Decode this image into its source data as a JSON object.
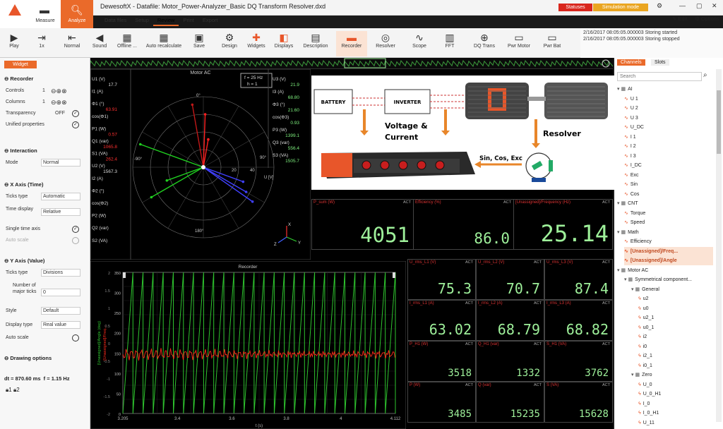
{
  "app": {
    "title": "DewesoftX - Datafile: Motor_Power-Analyzer_Basic DQ Transform Resolver.dxd",
    "modes": [
      {
        "label": "Measure"
      },
      {
        "label": "Analyze"
      }
    ],
    "menu_tabs": [
      "Data files",
      "Setup",
      "Review",
      "Print",
      "Export"
    ],
    "badge_status": "Statuses",
    "badge_sim": "Simulation mode",
    "edit": "Edit",
    "options": "Options"
  },
  "toolbar": [
    {
      "label": "Play",
      "icon": "play-icon"
    },
    {
      "label": "1x",
      "icon": "speed-icon"
    },
    {
      "label": "Normal",
      "icon": "normal-icon"
    },
    {
      "label": "Sound",
      "icon": "sound-icon"
    },
    {
      "label": "Offline ...",
      "icon": "calculator-icon"
    },
    {
      "label": "Auto recalculate",
      "icon": "recalculate-icon"
    },
    {
      "label": "Save",
      "icon": "save-icon"
    },
    {
      "label": "Design",
      "icon": "gear-icon"
    },
    {
      "label": "Widgets",
      "icon": "plus-icon"
    },
    {
      "label": "Displays",
      "icon": "displays-icon"
    },
    {
      "label": "Description",
      "icon": "description-icon"
    },
    {
      "label": "Recorder",
      "icon": "recorder-icon"
    },
    {
      "label": "Resolver",
      "icon": "resolver-icon"
    },
    {
      "label": "Scope",
      "icon": "scope-icon"
    },
    {
      "label": "FFT",
      "icon": "fft-icon"
    },
    {
      "label": "DQ Trans",
      "icon": "dq-icon"
    },
    {
      "label": "Pwr Motor",
      "icon": "motor-icon"
    },
    {
      "label": "Pwr Bat",
      "icon": "battery-icon"
    }
  ],
  "log": [
    "2/16/2017 08:05:05.000003 Storing started",
    "2/16/2017 08:05:05.000003 Storing stopped"
  ],
  "left_panel": {
    "tab": "Widget",
    "recorder": {
      "title": "Recorder",
      "controls_label": "Controls",
      "controls_value": "1",
      "columns_label": "Columns",
      "columns_value": "1",
      "transparency_label": "Transparency",
      "transparency_value": "OFF",
      "unified_label": "Unified properties"
    },
    "interaction": {
      "title": "Interaction",
      "mode_label": "Mode",
      "mode_value": "Normal"
    },
    "x_axis": {
      "title": "X Axis (Time)",
      "ticks_label": "Ticks type",
      "ticks_value": "Automatic",
      "time_label": "Time display",
      "time_value": "Relative",
      "single_label": "Single time axis",
      "auto_label": "Auto scale"
    },
    "y_axis": {
      "title": "Y Axis (Value)",
      "ticks_label": "Ticks type",
      "ticks_value": "Divisions",
      "major_label": "Number of major ticks",
      "major_value": "0",
      "style_label": "Style",
      "style_value": "Default",
      "disp_label": "Display type",
      "disp_value": "Real value",
      "auto_label": "Auto scale"
    },
    "drawing": {
      "title": "Drawing options"
    },
    "dt": "dt = 870.60 ms",
    "f": "f = 1.15 Hz",
    "lock1": "1",
    "lock2": "2"
  },
  "vector": {
    "title": "Motor AC",
    "f_value": "f = 25 Hz",
    "h_value": "h = 1",
    "left_labels": [
      "U1 (V)",
      "I1 (A)",
      "Φ1 (°)",
      "cos(Φ1)",
      "P1 (W)",
      "Q1 (var)",
      "S1 (VA)",
      "U2 (V)",
      "I2 (A)",
      "Φ2 (°)",
      "cos(Φ2)",
      "P2 (W)",
      "Q2 (var)",
      "S2 (VA)"
    ],
    "left_values": [
      "17.7",
      "",
      "63.91",
      "",
      "0.57",
      "1065.8",
      "262.4",
      "1567.3",
      "",
      "",
      "",
      "",
      "",
      ""
    ],
    "right_labels": [
      "U3 (V)",
      "I3 (A)",
      "Φ3 (°)",
      "cos(Φ3)",
      "P3 (W)",
      "Q3 (var)",
      "S3 (VA)"
    ],
    "right_values": [
      "21.9",
      "68.80",
      "21.60",
      "0.93",
      "1399.1",
      "556.4",
      "1505.7"
    ],
    "angle_0": "0°",
    "angle_90": "90°",
    "angle_m90": "-90°",
    "angle_180": "180°",
    "scale_20": "20",
    "scale_40": "40",
    "u_axis": "U [V]",
    "ax_x": "X",
    "ax_y": "Y",
    "ax_z": "Z"
  },
  "diagram": {
    "battery": "BATTERY",
    "inverter": "INVERTER",
    "voltage": "Voltage &",
    "current": "Current",
    "resolver": "Resolver",
    "signals": "Sin, Cos, Exc"
  },
  "displays_top": [
    {
      "label": "P_sum (W)",
      "value": "4051",
      "act": "ACT"
    },
    {
      "label": "Efficiency (%)",
      "value": "86.0",
      "act": "ACT"
    },
    {
      "label": "[Unassigned]/Frequency (Hz)",
      "value": "25.14",
      "act": "ACT"
    }
  ],
  "displays_grid": [
    {
      "label": "U_rms_L1 (V)",
      "value": "75.3",
      "act": "ACT"
    },
    {
      "label": "U_rms_L2 (V)",
      "value": "70.7",
      "act": "ACT"
    },
    {
      "label": "U_rms_L3 (V)",
      "value": "87.4",
      "act": "ACT"
    },
    {
      "label": "I_rms_L1 (A)",
      "value": "63.02",
      "act": "ACT"
    },
    {
      "label": "I_rms_L2 (A)",
      "value": "68.79",
      "act": "ACT"
    },
    {
      "label": "I_rms_L3 (A)",
      "value": "68.82",
      "act": "ACT"
    },
    {
      "label": "P_H1 (W)",
      "value": "3518",
      "act": "ACT"
    },
    {
      "label": "Q_H1 (var)",
      "value": "1332",
      "act": "ACT"
    },
    {
      "label": "S_H1 (VA)",
      "value": "3762",
      "act": "ACT"
    },
    {
      "label": "P (W)",
      "value": "3485",
      "act": "ACT"
    },
    {
      "label": "Q (var)",
      "value": "15235",
      "act": "ACT"
    },
    {
      "label": "S (VA)",
      "value": "15628",
      "act": "ACT"
    }
  ],
  "recorder": {
    "title": "Recorder",
    "x_ticks": [
      "3.205",
      "3.4",
      "3.6",
      "3.8",
      "4",
      "4.112"
    ],
    "xlabel": "t (s)",
    "y_ticks_left": [
      "2",
      "1.5",
      "1",
      "0.5",
      "0",
      "-0.5",
      "-1",
      "-1.5",
      "-2"
    ],
    "y_ticks_right": [
      "350",
      "300",
      "250",
      "200",
      "150",
      "100",
      "50",
      "0"
    ],
    "ylabel_left": "[Unassigned]/Angle (deg)",
    "ylabel_right": "[Unassigned]/Freq..."
  },
  "channels": {
    "tabs": [
      "Channels",
      "Slots"
    ],
    "search_placeholder": "Search",
    "tree": [
      {
        "t": "g",
        "d": 0,
        "label": "AI"
      },
      {
        "t": "c",
        "d": 1,
        "label": "U 1"
      },
      {
        "t": "c",
        "d": 1,
        "label": "U 2"
      },
      {
        "t": "c",
        "d": 1,
        "label": "U 3"
      },
      {
        "t": "c",
        "d": 1,
        "label": "U_DC"
      },
      {
        "t": "c",
        "d": 1,
        "label": "I 1"
      },
      {
        "t": "c",
        "d": 1,
        "label": "I 2"
      },
      {
        "t": "c",
        "d": 1,
        "label": "I 3"
      },
      {
        "t": "c",
        "d": 1,
        "label": "I_DC"
      },
      {
        "t": "c",
        "d": 1,
        "label": "Exc"
      },
      {
        "t": "c",
        "d": 1,
        "label": "Sin"
      },
      {
        "t": "c",
        "d": 1,
        "label": "Cos"
      },
      {
        "t": "g",
        "d": 0,
        "label": "CNT"
      },
      {
        "t": "c",
        "d": 1,
        "label": "Torque"
      },
      {
        "t": "c",
        "d": 1,
        "label": "Speed"
      },
      {
        "t": "g",
        "d": 0,
        "label": "Math"
      },
      {
        "t": "c",
        "d": 1,
        "label": "Efficiency"
      },
      {
        "t": "h",
        "d": 1,
        "label": "[Unassigned]/Freq..."
      },
      {
        "t": "h",
        "d": 1,
        "label": "[Unassigned]/Angle"
      },
      {
        "t": "g",
        "d": 0,
        "label": "Motor AC"
      },
      {
        "t": "g",
        "d": 1,
        "label": "Symmetrical component..."
      },
      {
        "t": "g",
        "d": 2,
        "label": "General"
      },
      {
        "t": "c",
        "d": 3,
        "label": "u2"
      },
      {
        "t": "c",
        "d": 3,
        "label": "u0"
      },
      {
        "t": "c",
        "d": 3,
        "label": "u2_1"
      },
      {
        "t": "c",
        "d": 3,
        "label": "u0_1"
      },
      {
        "t": "c",
        "d": 3,
        "label": "i2"
      },
      {
        "t": "c",
        "d": 3,
        "label": "i0"
      },
      {
        "t": "c",
        "d": 3,
        "label": "i2_1"
      },
      {
        "t": "c",
        "d": 3,
        "label": "i0_1"
      },
      {
        "t": "g",
        "d": 2,
        "label": "Zero"
      },
      {
        "t": "c",
        "d": 3,
        "label": "U_0"
      },
      {
        "t": "c",
        "d": 3,
        "label": "U_0_H1"
      },
      {
        "t": "c",
        "d": 3,
        "label": "I_0"
      },
      {
        "t": "c",
        "d": 3,
        "label": "I_0_H1"
      },
      {
        "t": "c",
        "d": 3,
        "label": "U_11"
      }
    ]
  },
  "colors": {
    "accent": "#ea6a2a",
    "display_green": "#9ef09a",
    "trace_red": "#ff2a1a",
    "trace_green": "#2ec42e"
  }
}
